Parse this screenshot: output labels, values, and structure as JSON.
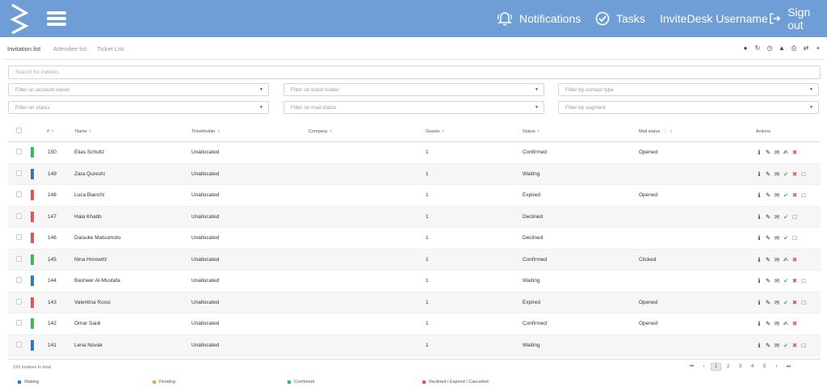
{
  "header": {
    "notifications_label": "Notifications",
    "tasks_label": "Tasks",
    "username": "InviteDesk Username",
    "signout_label": "Sign out"
  },
  "tabs": [
    "Invitation list",
    "Attendee list",
    "Ticket List"
  ],
  "toolbar_icons": [
    "users-icon",
    "refresh-icon",
    "clock-icon",
    "upload-icon",
    "print-icon",
    "shuffle-icon",
    "plus-icon"
  ],
  "search": {
    "placeholder": "Search for invitees"
  },
  "filters": {
    "account_owner": "Filter on account owner",
    "ticket_holder": "Filter on ticket holder",
    "contact_type": "Filter by contact type",
    "status": "Filter on status",
    "mail_status": "Filter on mail status",
    "segment": "Filter by segment"
  },
  "columns": {
    "num": "#",
    "name": "Name",
    "ticketholder": "Ticketholder",
    "company": "Company",
    "guests": "Guests",
    "status": "Status",
    "mail_status": "Mail status",
    "actions": "Actions"
  },
  "colors": {
    "waiting": "#2f78c4",
    "pending": "#f0a04b",
    "confirmed": "#3cba54",
    "declined": "#e05555",
    "header_bg": "#6f9ed6"
  },
  "rows": [
    {
      "num": "150",
      "name": "Elias Schultz",
      "ticketholder": "Unallocated",
      "company": "",
      "guests": "1",
      "status": "Confirmed",
      "mail_status": "Opened",
      "color": "confirmed",
      "actions": [
        "info",
        "edit",
        "mail",
        "note",
        "cross"
      ]
    },
    {
      "num": "149",
      "name": "Zara Qureshi",
      "ticketholder": "Unallocated",
      "company": "",
      "guests": "1",
      "status": "Waiting",
      "mail_status": "",
      "color": "waiting",
      "actions": [
        "info",
        "edit",
        "mail",
        "check",
        "cross",
        "trash"
      ]
    },
    {
      "num": "148",
      "name": "Luca Bianchi",
      "ticketholder": "Unallocated",
      "company": "",
      "guests": "1",
      "status": "Expired",
      "mail_status": "Opened",
      "color": "declined",
      "actions": [
        "info",
        "edit",
        "mail",
        "check",
        "cross",
        "trash"
      ]
    },
    {
      "num": "147",
      "name": "Hala Khatib",
      "ticketholder": "Unallocated",
      "company": "",
      "guests": "1",
      "status": "Declined",
      "mail_status": "",
      "color": "declined",
      "actions": [
        "info",
        "edit",
        "mail",
        "check",
        "trash"
      ]
    },
    {
      "num": "146",
      "name": "Daisuke Matsumoto",
      "ticketholder": "Unallocated",
      "company": "",
      "guests": "1",
      "status": "Declined",
      "mail_status": "",
      "color": "declined",
      "actions": [
        "info",
        "edit",
        "mail",
        "check",
        "trash"
      ]
    },
    {
      "num": "145",
      "name": "Nina Horowitz",
      "ticketholder": "Unallocated",
      "company": "",
      "guests": "1",
      "status": "Confirmed",
      "mail_status": "Clicked",
      "color": "confirmed",
      "actions": [
        "info",
        "edit",
        "mail",
        "note",
        "cross"
      ]
    },
    {
      "num": "144",
      "name": "Basheer Al-Mustafa",
      "ticketholder": "Unallocated",
      "company": "",
      "guests": "1",
      "status": "Waiting",
      "mail_status": "",
      "color": "waiting",
      "actions": [
        "info",
        "edit",
        "mail",
        "check",
        "cross",
        "trash"
      ]
    },
    {
      "num": "143",
      "name": "Valentina Rossi",
      "ticketholder": "Unallocated",
      "company": "",
      "guests": "1",
      "status": "Expired",
      "mail_status": "Opened",
      "color": "declined",
      "actions": [
        "info",
        "edit",
        "mail",
        "check",
        "cross",
        "trash"
      ]
    },
    {
      "num": "142",
      "name": "Omar Saidi",
      "ticketholder": "Unallocated",
      "company": "",
      "guests": "1",
      "status": "Confirmed",
      "mail_status": "Opened",
      "color": "confirmed",
      "actions": [
        "info",
        "edit",
        "mail",
        "note",
        "cross"
      ]
    },
    {
      "num": "141",
      "name": "Lena Novak",
      "ticketholder": "Unallocated",
      "company": "",
      "guests": "1",
      "status": "Waiting",
      "mail_status": "",
      "color": "waiting",
      "actions": [
        "info",
        "edit",
        "mail",
        "check",
        "cross",
        "trash"
      ]
    }
  ],
  "footer": {
    "total": "150 invitees in total",
    "pages": [
      "1",
      "2",
      "3",
      "4",
      "5"
    ],
    "active_page": "1"
  },
  "legend": [
    {
      "label": "Waiting",
      "color": "waiting"
    },
    {
      "label": "Pending",
      "color": "pending"
    },
    {
      "label": "Confirmed",
      "color": "confirmed"
    },
    {
      "label": "Declined / Expired / Cancelled",
      "color": "declined"
    }
  ]
}
